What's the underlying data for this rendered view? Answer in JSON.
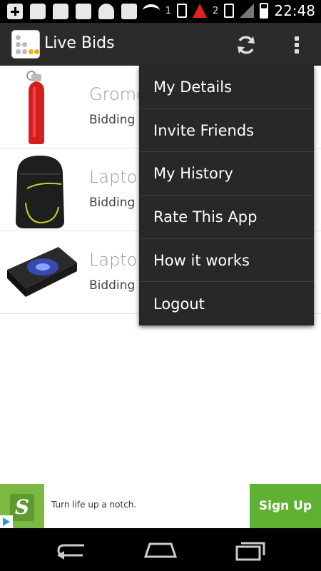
{
  "status_bar": {
    "time": "22:48",
    "sim1": "1",
    "sim2": "2"
  },
  "action_bar": {
    "title": "Live Bids",
    "icons": [
      "refresh-icon",
      "overflow-menu-icon"
    ]
  },
  "list": {
    "items": [
      {
        "title": "Gromo",
        "subtitle": "Bidding e",
        "image": "red-water-bottle"
      },
      {
        "title": "Laptop",
        "subtitle": "Bidding e",
        "image": "black-backpack"
      },
      {
        "title": "Laptop",
        "subtitle": "Bidding e",
        "image": "laptop-cooling-pad"
      }
    ]
  },
  "menu": {
    "items": [
      {
        "label": "My Details"
      },
      {
        "label": "Invite Friends"
      },
      {
        "label": "My History"
      },
      {
        "label": "Rate This App"
      },
      {
        "label": "How it works"
      },
      {
        "label": "Logout"
      }
    ]
  },
  "ad": {
    "text": "Turn life up a notch.",
    "button": "Sign Up",
    "logo_letter": "S",
    "brand_color": "#5fb133"
  },
  "colors": {
    "action_bar": "#2b2b2b",
    "menu_bg": "#282828"
  }
}
